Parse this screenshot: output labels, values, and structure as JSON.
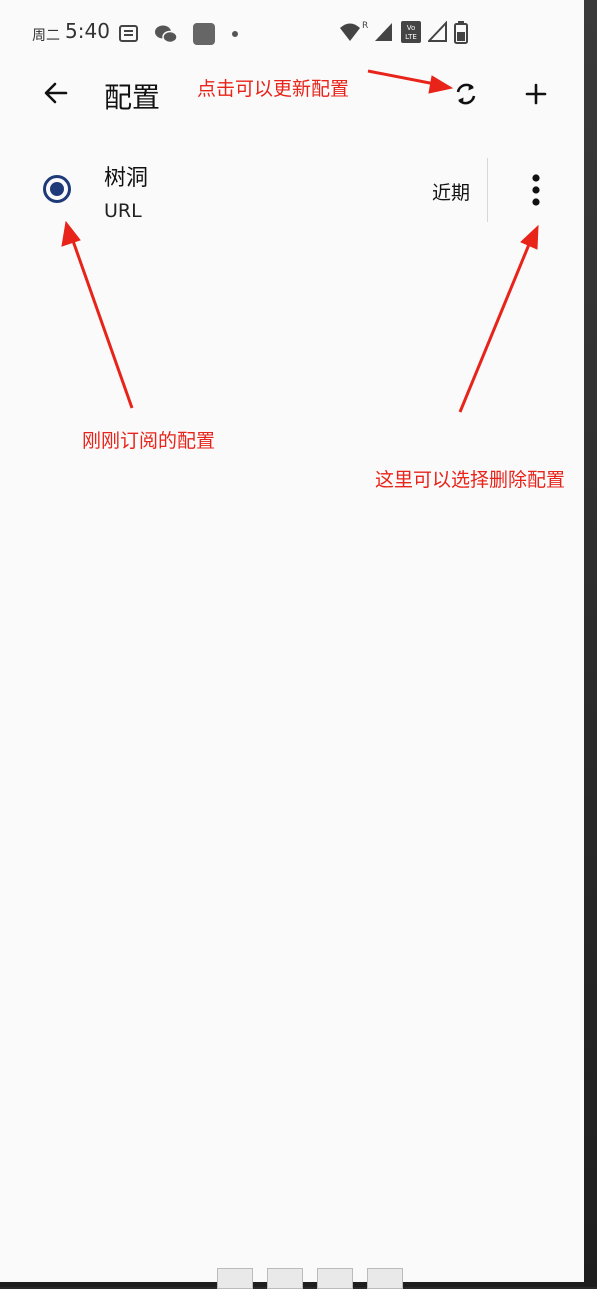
{
  "status_bar": {
    "day": "周二",
    "time": "5:40",
    "left_icons": [
      "notes-icon",
      "wechat-icon",
      "app-square-icon",
      "dot-icon"
    ],
    "right_icons": [
      "wifi-icon",
      "signal-icon",
      "volte-icon",
      "signal-2-icon",
      "battery-icon"
    ],
    "volte_label": "Vo LTE",
    "wifi_badge": "R"
  },
  "app_bar": {
    "title": "配置"
  },
  "profiles": [
    {
      "name": "树洞",
      "type": "URL",
      "updated": "近期",
      "selected": true
    }
  ],
  "annotations": {
    "refresh": "点击可以更新配置",
    "subscribed": "刚刚订阅的配置",
    "delete": "这里可以选择删除配置"
  },
  "colors": {
    "accent": "#1e3a78",
    "annotation": "#e8241a",
    "background": "#fafafa"
  }
}
